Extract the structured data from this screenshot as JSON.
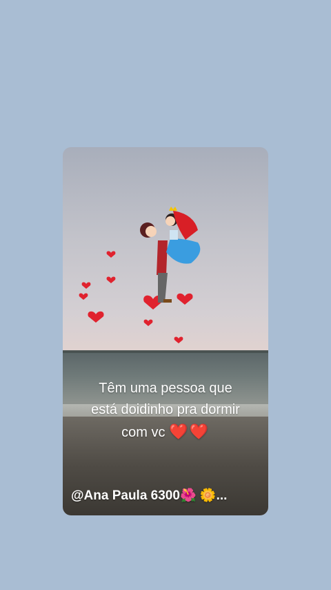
{
  "post": {
    "caption_line1": "Têm uma pessoa que",
    "caption_line2": "está doidinho pra dormir",
    "caption_line3": "com vc",
    "caption_hearts": "❤️❤️",
    "username": "@Ana Paula 6300",
    "username_emoji1": "🌺",
    "username_emoji2": "🌼",
    "username_suffix": "..."
  },
  "illustration": {
    "description_icon": "kissing-couple-icon",
    "heart_color": "#e0222e"
  },
  "colors": {
    "background": "#a9bdd3",
    "text": "#ffffff"
  }
}
